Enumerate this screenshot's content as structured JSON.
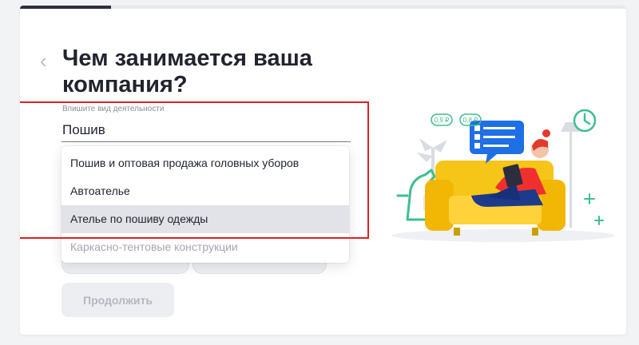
{
  "title": "Чем занимается ваша компания?",
  "progress": 0.15,
  "field": {
    "label": "Впишите вид деятельности",
    "value": "Пошив"
  },
  "suggestions": [
    {
      "label": "Пошив и оптовая продажа головных уборов"
    },
    {
      "label": "Автоателье"
    },
    {
      "label": "Ателье по пошиву одежды",
      "selected": true
    },
    {
      "label": "Каркасно-тентовые конструкции"
    }
  ],
  "continue_label": "Продолжить",
  "illustration": {
    "badges": [
      "0,9 ₽",
      "0,8 ₽"
    ]
  },
  "colors": {
    "accent": "#2b2e3f",
    "highlight": "#e0201f",
    "sofa": "#f5c518",
    "chat": "#1f6fe5",
    "green": "#3fbf8e",
    "shirt": "#f0302e"
  },
  "icons": [
    "chevron-left-icon",
    "chat-checklist-icon",
    "clock-icon"
  ]
}
